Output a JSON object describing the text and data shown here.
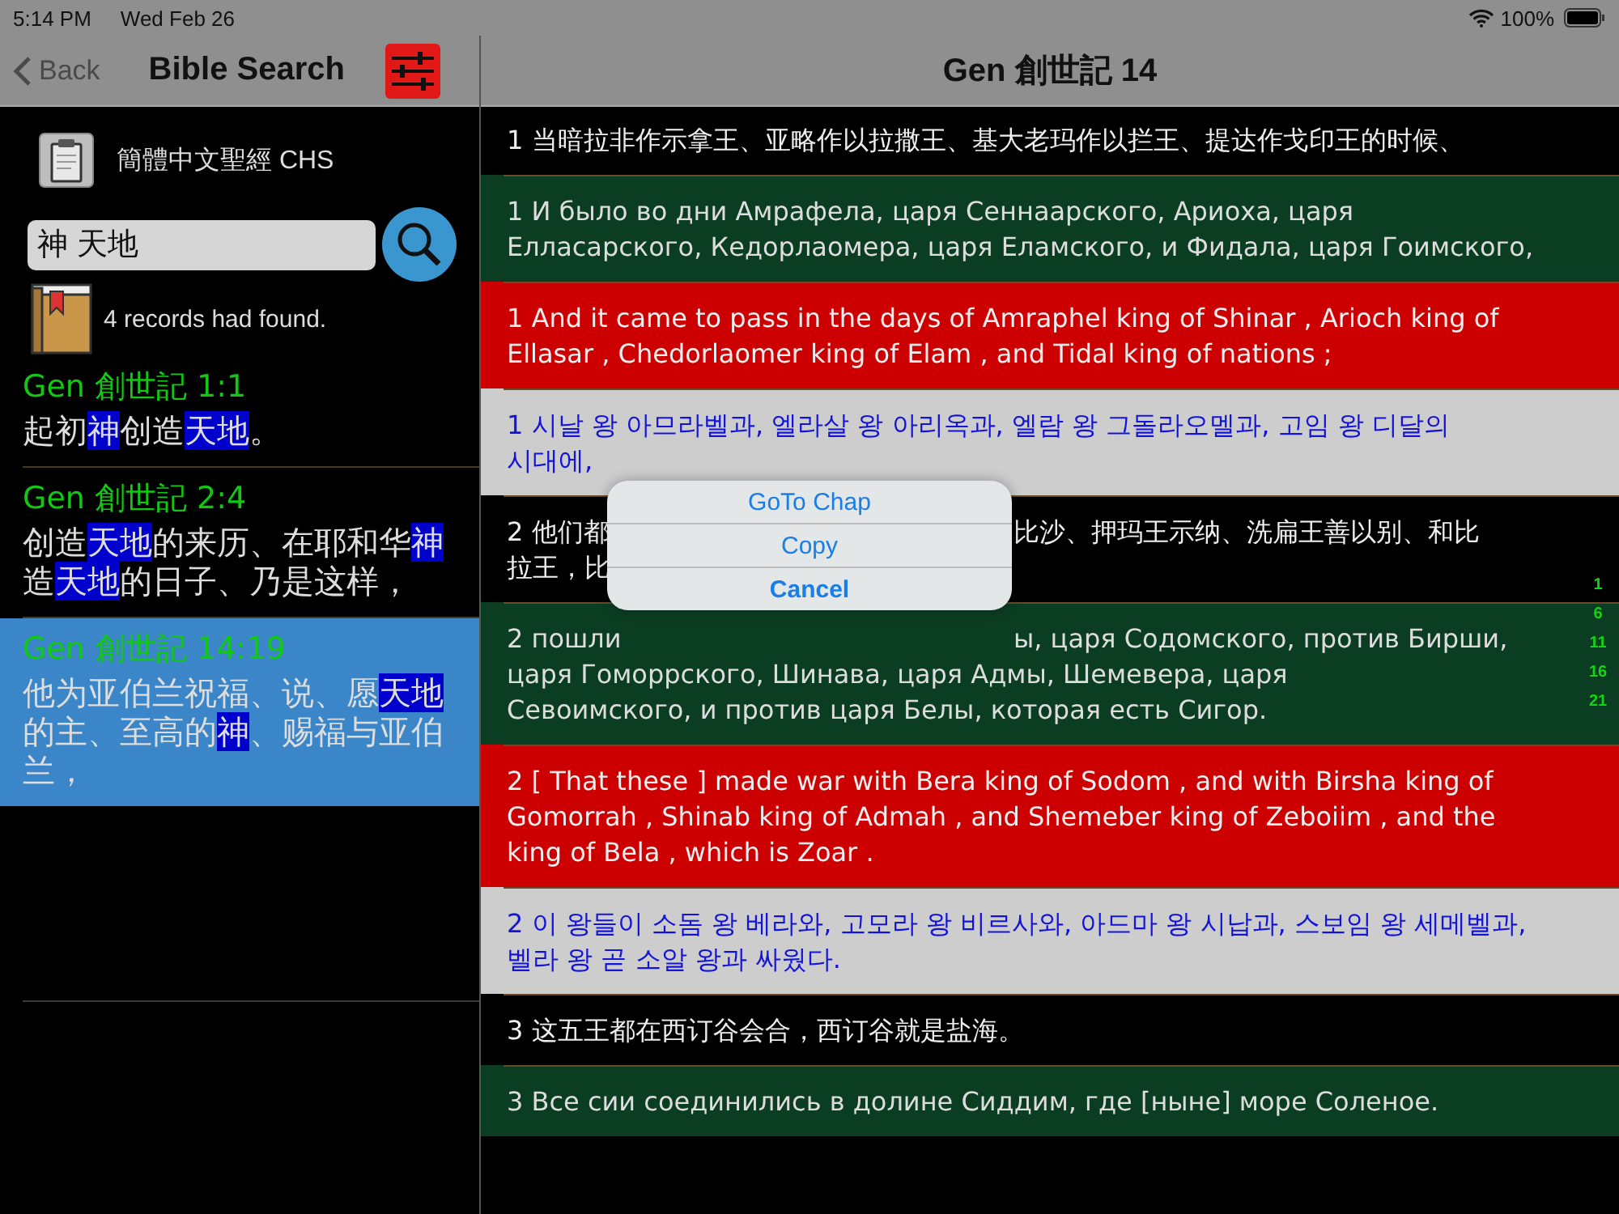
{
  "status_bar": {
    "time": "5:14 PM",
    "date": "Wed Feb 26",
    "battery": "100%"
  },
  "sidebar": {
    "back": {
      "label": "Back",
      "disabled": true
    },
    "title": "Bible Search",
    "version": "簡體中文聖經 CHS",
    "search": {
      "value": "神 天地"
    },
    "result_count": "4 records had found.",
    "results": [
      {
        "reference": "Gen 創世記 1:1",
        "selected": false,
        "segments": [
          {
            "text": "起初",
            "highlight": false
          },
          {
            "text": "神",
            "highlight": true
          },
          {
            "text": "创造",
            "highlight": false
          },
          {
            "text": "天地",
            "highlight": true
          },
          {
            "text": "。",
            "highlight": false
          }
        ]
      },
      {
        "reference": "Gen 創世記 2:4",
        "selected": false,
        "segments": [
          {
            "text": "创造",
            "highlight": false
          },
          {
            "text": "天地",
            "highlight": true
          },
          {
            "text": "的来历、在耶和华",
            "highlight": false
          },
          {
            "text": "神",
            "highlight": true
          },
          {
            "text": "造",
            "highlight": false
          },
          {
            "text": "天地",
            "highlight": true
          },
          {
            "text": "的日子、乃是这样，",
            "highlight": false
          }
        ]
      },
      {
        "reference": "Gen 創世記 14:19",
        "selected": true,
        "segments": [
          {
            "text": "他为亚伯兰祝福、说、愿",
            "highlight": false
          },
          {
            "text": "天地",
            "highlight": true
          },
          {
            "text": "的主、至高的",
            "highlight": false
          },
          {
            "text": "神",
            "highlight": true
          },
          {
            "text": "、赐福与亚伯兰，",
            "highlight": false
          }
        ]
      }
    ]
  },
  "main": {
    "title": "Gen 創世記 14",
    "verses": [
      {
        "kind": "zh",
        "text": "1 当暗拉非作示拿王、亚略作以拉撒王、基大老玛作以拦王、提达作戈印王的时候、"
      },
      {
        "kind": "ru",
        "text": "1 И было во дни Амрафела, царя Сеннаарского, Ариоха, царя Елласарского, Кедорлаомера, царя Еламского, и Фидала, царя Гоимского,"
      },
      {
        "kind": "en",
        "text": "1 And it came to pass in the days of Amraphel king of Shinar , Arioch king of Ellasar , Chedorlaomer king of Elam , and Tidal king of nations ;"
      },
      {
        "kind": "ko",
        "text": "1 시날 왕 아므라벨과, 엘라살 왕 아리옥과, 엘람 왕 그돌라오멜과, 고임 왕 디달의 시대에,"
      },
      {
        "kind": "zh",
        "lines": [
          [
            "2 他们都",
            "比沙、押玛王示纳、洗扁王善以别、和比"
          ],
          [
            "拉王，比"
          ]
        ]
      },
      {
        "kind": "ru",
        "lines": [
          [
            "2 пошли",
            "ы, царя Содомского, против Бирши,"
          ],
          [
            "царя Гоморрского, Шинава, царя Адмы, Шемевера, царя"
          ],
          [
            "Севоимского, и против царя Белы, которая есть Сигор."
          ]
        ]
      },
      {
        "kind": "en",
        "text": "2 [ That these ] made war with Bera king of Sodom , and with Birsha king of Gomorrah , Shinab king of Admah , and Shemeber king of Zeboiim , and the king of Bela , which is Zoar ."
      },
      {
        "kind": "ko",
        "text": "2 이 왕들이 소돔 왕 베라와, 고모라 왕 비르사와, 아드마 왕 시납과, 스보임 왕 세메벨과, 벨라 왕 곧 소알 왕과 싸웠다."
      },
      {
        "kind": "zh",
        "text": "3 这五王都在西订谷会合，西订谷就是盐海。"
      },
      {
        "kind": "ru",
        "text": "3 Все сии соединились в долине Сиддим, где [ныне] море Соленое."
      }
    ],
    "index": [
      "1",
      "6",
      "11",
      "16",
      "21"
    ]
  },
  "action_sheet": [
    {
      "label": "GoTo Chap",
      "kind": "action"
    },
    {
      "label": "Copy",
      "kind": "action"
    },
    {
      "label": "Cancel",
      "kind": "cancel"
    }
  ]
}
